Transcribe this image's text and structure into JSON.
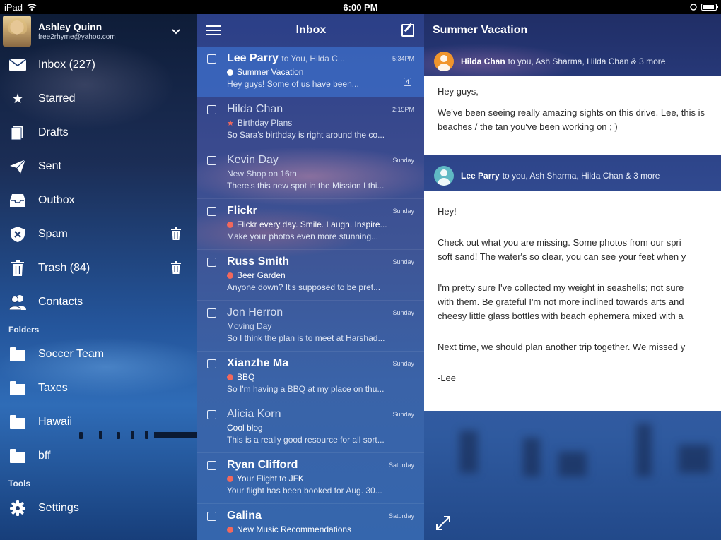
{
  "status_bar": {
    "device": "iPad",
    "time": "6:00 PM"
  },
  "account": {
    "name": "Ashley Quinn",
    "email": "free2rhyme@yahoo.com"
  },
  "nav": [
    {
      "label": "Inbox (227)",
      "icon": "mail-icon"
    },
    {
      "label": "Starred",
      "icon": "star-icon"
    },
    {
      "label": "Drafts",
      "icon": "drafts-icon"
    },
    {
      "label": "Sent",
      "icon": "paper-plane-icon"
    },
    {
      "label": "Outbox",
      "icon": "outbox-tray-icon"
    },
    {
      "label": "Spam",
      "icon": "spam-shield-icon"
    },
    {
      "label": "Trash (84)",
      "icon": "trash-icon"
    },
    {
      "label": "Contacts",
      "icon": "contacts-icon"
    }
  ],
  "folders_label": "Folders",
  "folders": [
    {
      "label": "Soccer Team"
    },
    {
      "label": "Taxes"
    },
    {
      "label": "Hawaii"
    },
    {
      "label": "bff"
    }
  ],
  "tools_label": "Tools",
  "tools": [
    {
      "label": "Settings",
      "icon": "gear-icon"
    }
  ],
  "list": {
    "title": "Inbox",
    "messages": [
      {
        "sender": "Lee Parry",
        "recipients": "to You, Hilda C...",
        "time": "5:34PM",
        "subject": "Summer Vacation",
        "preview": "Hey guys!  Some of us have been...",
        "marker": "white-dot",
        "badge": "4",
        "unread": true,
        "selected": true
      },
      {
        "sender": "Hilda Chan",
        "recipients": "",
        "time": "2:15PM",
        "subject": "Birthday Plans",
        "preview": "So Sara's birthday is right around the co...",
        "marker": "star",
        "badge": "",
        "unread": false,
        "selected": false
      },
      {
        "sender": "Kevin Day",
        "recipients": "",
        "time": "Sunday",
        "subject": "New Shop on 16th",
        "preview": "There's this new spot in the Mission I thi...",
        "marker": "",
        "badge": "",
        "unread": false,
        "selected": false
      },
      {
        "sender": "Flickr",
        "recipients": "",
        "time": "Sunday",
        "subject": "Flickr every day. Smile. Laugh. Inspire...",
        "preview": "Make your photos even more stunning...",
        "marker": "red-dot",
        "badge": "",
        "unread": true,
        "selected": false
      },
      {
        "sender": "Russ Smith",
        "recipients": "",
        "time": "Sunday",
        "subject": "Beer Garden",
        "preview": "Anyone down? It's supposed to be pret...",
        "marker": "red-dot",
        "badge": "",
        "unread": true,
        "selected": false
      },
      {
        "sender": "Jon Herron",
        "recipients": "",
        "time": "Sunday",
        "subject": "Moving Day",
        "preview": "So I think the plan is to meet at Harshad...",
        "marker": "",
        "badge": "",
        "unread": false,
        "selected": false
      },
      {
        "sender": "Xianzhe Ma",
        "recipients": "",
        "time": "Sunday",
        "subject": "BBQ",
        "preview": "So I'm having a BBQ at my place on thu...",
        "marker": "red-dot",
        "badge": "",
        "unread": true,
        "selected": false
      },
      {
        "sender": "Alicia Korn",
        "recipients": "",
        "time": "Sunday",
        "subject": "Cool blog",
        "preview": "This is a really good resource for all sort...",
        "marker": "",
        "badge": "",
        "unread": false,
        "selected": false
      },
      {
        "sender": "Ryan Clifford",
        "recipients": "",
        "time": "Saturday",
        "subject": "Your Flight to JFK",
        "preview": "Your flight has been booked for Aug. 30...",
        "marker": "red-dot",
        "badge": "",
        "unread": true,
        "selected": false
      },
      {
        "sender": "Galina",
        "recipients": "",
        "time": "Saturday",
        "subject": "New Music Recommendations",
        "preview": "",
        "marker": "red-dot",
        "badge": "",
        "unread": true,
        "selected": false
      }
    ]
  },
  "reading": {
    "title": "Summer Vacation",
    "thread": [
      {
        "from": "Hilda Chan",
        "to": "to you, Ash Sharma, Hilda Chan & 3 more",
        "avatar_color": "#f0952c",
        "body": [
          "Hey guys,",
          "",
          "We've been seeing really amazing sights on this drive. Lee, this is",
          "beaches / the tan you've been working on ; )"
        ]
      },
      {
        "from": "Lee Parry",
        "to": "to you, Ash Sharma, Hilda Chan & 3 more",
        "avatar_color": "#5fb9c4",
        "body": [
          "Hey!",
          "",
          "Check out what you are missing. Some photos from our spri",
          "soft sand! The water's so clear, you can see your feet when y",
          "",
          "I'm pretty sure I've collected my weight in seashells; not sure",
          "with them. Be grateful I'm not more inclined towards arts and",
          "cheesy little glass bottles with beach ephemera mixed with a",
          "",
          "Next time, we should plan another trip together. We missed y",
          "",
          "-Lee"
        ]
      }
    ]
  },
  "colors": {
    "selected_row": "#3c6ec8",
    "red_marker": "#f2685c",
    "card_bg": "#ffffff"
  }
}
